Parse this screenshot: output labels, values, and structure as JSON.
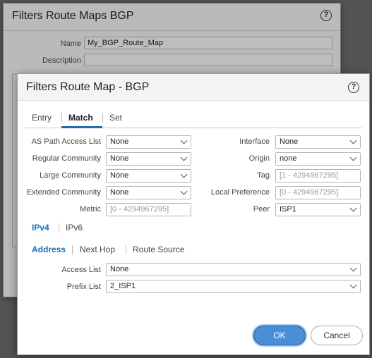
{
  "background_dialog": {
    "title": "Filters Route Maps BGP",
    "name_label": "Name",
    "name_value": "My_BGP_Route_Map",
    "description_label": "Description",
    "description_value": ""
  },
  "dialog": {
    "title": "Filters Route Map - BGP",
    "help_glyph": "?",
    "tabs": [
      "Entry",
      "Match",
      "Set"
    ],
    "active_tab": "Match",
    "left_fields": [
      {
        "label": "AS Path Access List",
        "value": "None",
        "type": "select"
      },
      {
        "label": "Regular Community",
        "value": "None",
        "type": "select"
      },
      {
        "label": "Large Community",
        "value": "None",
        "type": "select"
      },
      {
        "label": "Extended Community",
        "value": "None",
        "type": "select"
      },
      {
        "label": "Metric",
        "value": "[0 - 4294967295]",
        "type": "input"
      }
    ],
    "right_fields": [
      {
        "label": "Interface",
        "value": "None",
        "type": "select"
      },
      {
        "label": "Origin",
        "value": "none",
        "type": "select"
      },
      {
        "label": "Tag",
        "value": "[1 - 4294967295]",
        "type": "input"
      },
      {
        "label": "Local Preference",
        "value": "[0 - 4294967295]",
        "type": "input"
      },
      {
        "label": "Peer",
        "value": "ISP1",
        "type": "select"
      }
    ],
    "ip_tabs": [
      "IPv4",
      "IPv6"
    ],
    "active_ip_tab": "IPv4",
    "address_tabs": [
      "Address",
      "Next Hop",
      "Route Source"
    ],
    "active_address_tab": "Address",
    "access_list_label": "Access List",
    "access_list_value": "None",
    "prefix_list_label": "Prefix List",
    "prefix_list_value": "2_ISP1",
    "ok_label": "OK",
    "cancel_label": "Cancel"
  },
  "colors": {
    "accent": "#1b6fb8",
    "ok_button": "#4a8fd6"
  }
}
